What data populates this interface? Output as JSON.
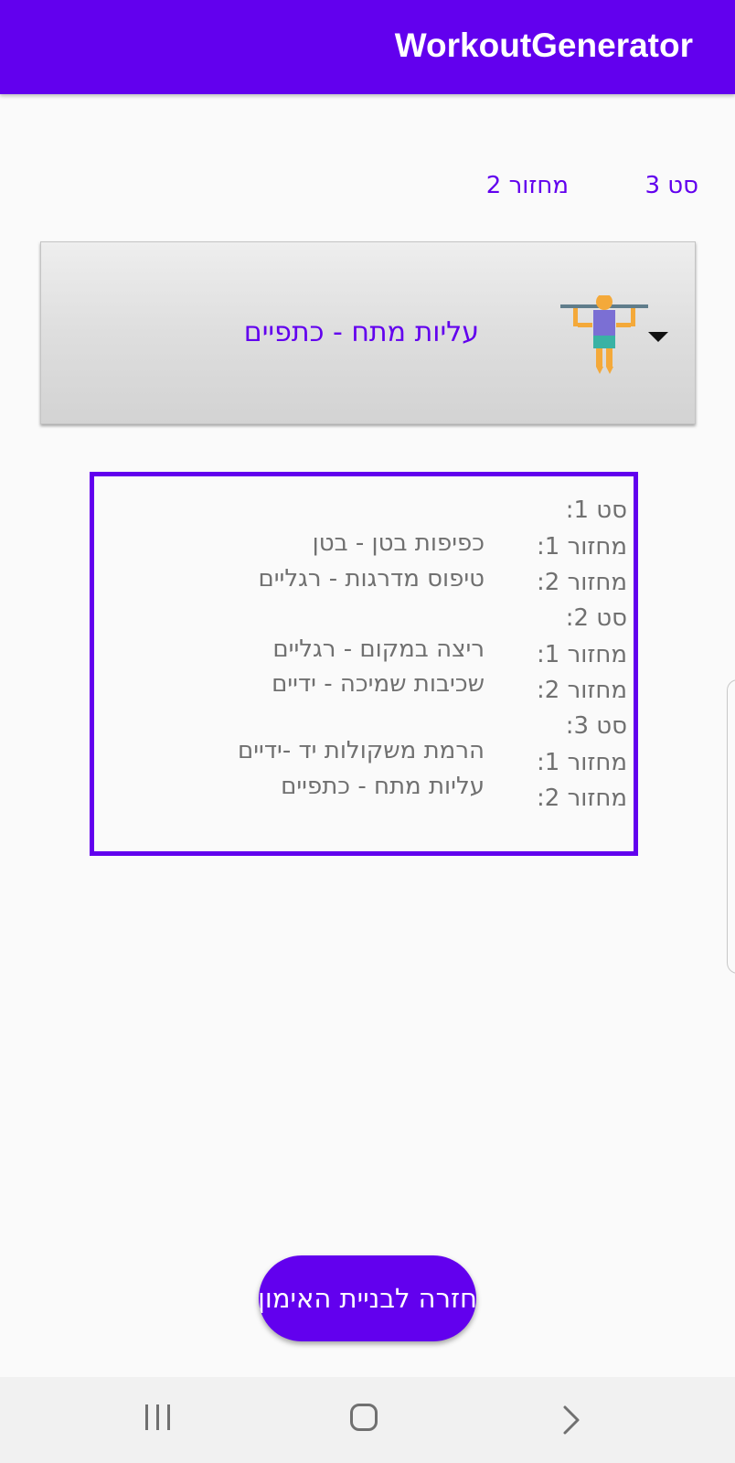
{
  "app_bar": {
    "title": "WorkoutGenerator",
    "color": "#6200ee"
  },
  "header": {
    "set_label": "סט 3",
    "round_label": "מחזור 2"
  },
  "exercise_spinner": {
    "selected_label": "עליות מתח - כתפיים",
    "icon": "pull-up-person-icon",
    "dropdown_icon": "dropdown-arrow-icon"
  },
  "summary": {
    "sets": [
      {
        "title": "סט 1:",
        "rounds": [
          {
            "label": "מחזור 1:",
            "exercise": "כפיפות בטן - בטן"
          },
          {
            "label": "מחזור 2:",
            "exercise": "טיפוס מדרגות - רגליים"
          }
        ]
      },
      {
        "title": "סט 2:",
        "rounds": [
          {
            "label": "מחזור 1:",
            "exercise": "ריצה במקום - רגליים"
          },
          {
            "label": "מחזור 2:",
            "exercise": "שכיבות שמיכה - ידיים"
          }
        ]
      },
      {
        "title": "סט 3:",
        "rounds": [
          {
            "label": "מחזור 1:",
            "exercise": "הרמת משקולות יד -ידיים"
          },
          {
            "label": "מחזור 2:",
            "exercise": "עליות מתח - כתפיים"
          }
        ]
      }
    ]
  },
  "back_button": {
    "label": "חזרה לבניית האימון"
  },
  "nav_bar": {
    "recents_icon": "recents-icon",
    "home_icon": "home-icon",
    "back_icon": "back-chevron-icon"
  },
  "colors": {
    "accent": "#6200ee",
    "summary_text": "#707070",
    "background": "#fafafa"
  }
}
